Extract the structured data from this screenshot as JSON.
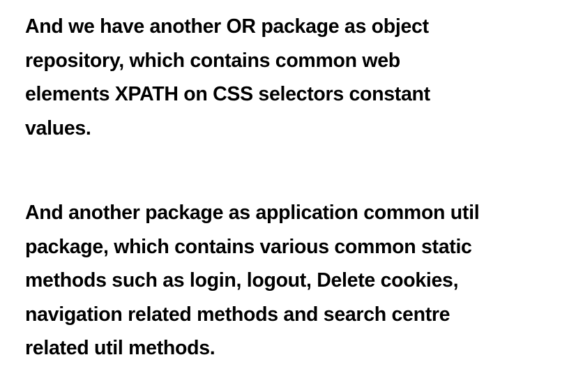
{
  "paragraphs": [
    {
      "lines": [
        "And we have another OR package as object",
        "repository, which contains common web",
        "elements XPATH on CSS selectors constant",
        "values."
      ]
    },
    {
      "lines": [
        "And another package as application common util",
        "package, which contains various common static",
        "methods such as login, logout, Delete cookies,",
        "navigation related methods and search centre",
        "related util methods."
      ]
    }
  ]
}
